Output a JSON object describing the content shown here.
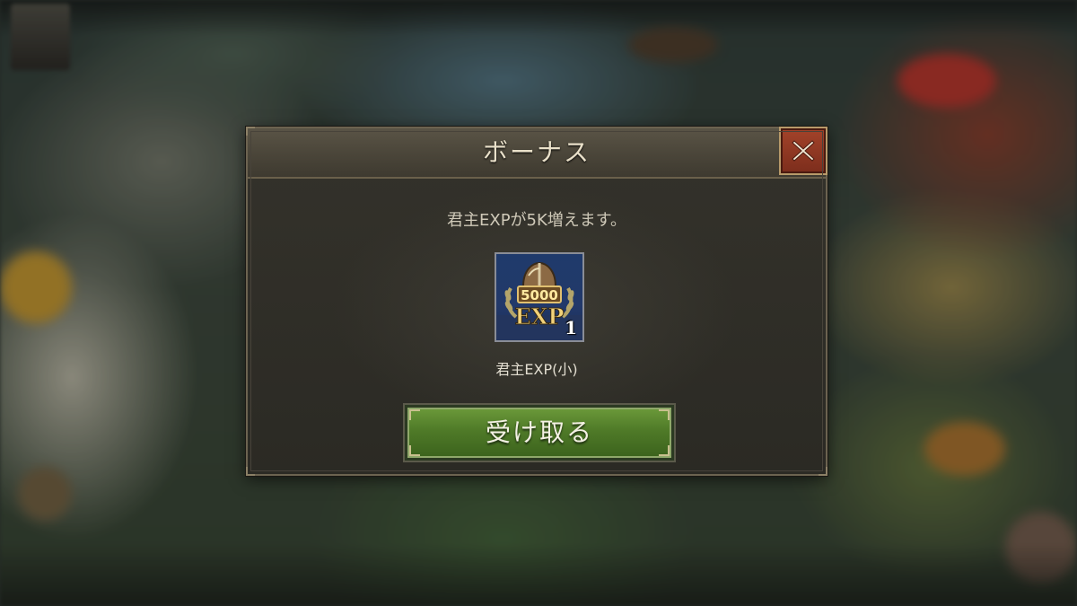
{
  "dialog": {
    "title": "ボーナス",
    "message": "君主EXPが5K増えます。",
    "close_label": "X",
    "item": {
      "icon": "exp-shield-icon",
      "badge_value": "5000",
      "badge_text": "EXP",
      "count": "1",
      "name": "君主EXP(小)"
    },
    "receive_label": "受け取る"
  },
  "colors": {
    "close_button": "#a3432a",
    "receive_button": "#4f7a28",
    "item_background": "#1f3a6b",
    "panel_background": "#2b2a24"
  }
}
